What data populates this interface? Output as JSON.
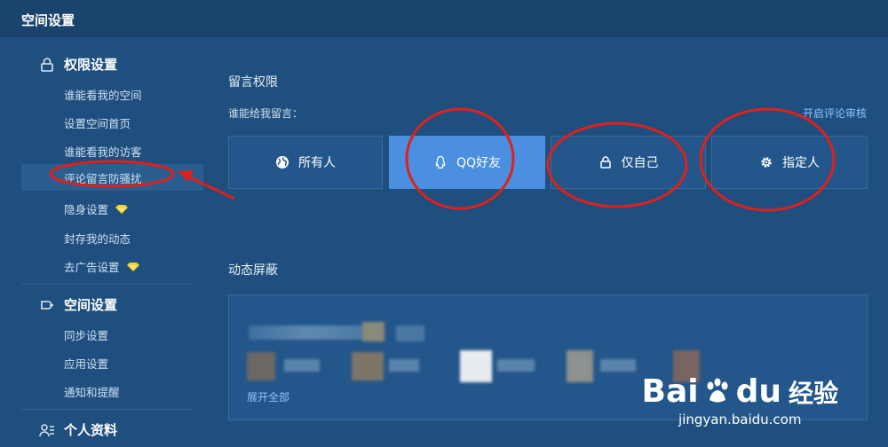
{
  "header": {
    "title": "空间设置"
  },
  "sidebar": {
    "sections": [
      {
        "title": "权限设置",
        "icon": "lock-icon",
        "items": [
          {
            "label": "谁能看我的空间"
          },
          {
            "label": "设置空间首页"
          },
          {
            "label": "谁能看我的访客"
          },
          {
            "label": "评论留言防骚扰",
            "active": true
          },
          {
            "label": "隐身设置",
            "badge": "diamond-icon"
          },
          {
            "label": "封存我的动态"
          },
          {
            "label": "去广告设置",
            "badge": "diamond-icon"
          }
        ]
      },
      {
        "title": "空间设置",
        "icon": "space-icon",
        "items": [
          {
            "label": "同步设置"
          },
          {
            "label": "应用设置"
          },
          {
            "label": "通知和提醒"
          }
        ]
      },
      {
        "title": "个人资料",
        "icon": "profile-icon"
      }
    ]
  },
  "main": {
    "message_permission": {
      "heading": "留言权限",
      "question": "谁能给我留言：",
      "review_link": "开启评论审核",
      "options": [
        {
          "label": "所有人",
          "icon": "globe-icon",
          "selected": false
        },
        {
          "label": "QQ好友",
          "icon": "qq-penguin-icon",
          "selected": true
        },
        {
          "label": "仅自己",
          "icon": "lock-icon",
          "selected": false
        },
        {
          "label": "指定人",
          "icon": "gear-icon",
          "selected": false
        }
      ]
    },
    "feed_block": {
      "heading": "动态屏蔽",
      "expand_link": "展开全部"
    }
  },
  "watermark": {
    "brand_left": "Bai",
    "brand_right": "du",
    "product": "经验",
    "url": "jingyan.baidu.com"
  },
  "colors": {
    "background": "#1f4f7e",
    "selected": "#4a8fe0",
    "link": "#8fc3ff",
    "annotation": "#e0201b",
    "diamond": "#f5d22e"
  }
}
